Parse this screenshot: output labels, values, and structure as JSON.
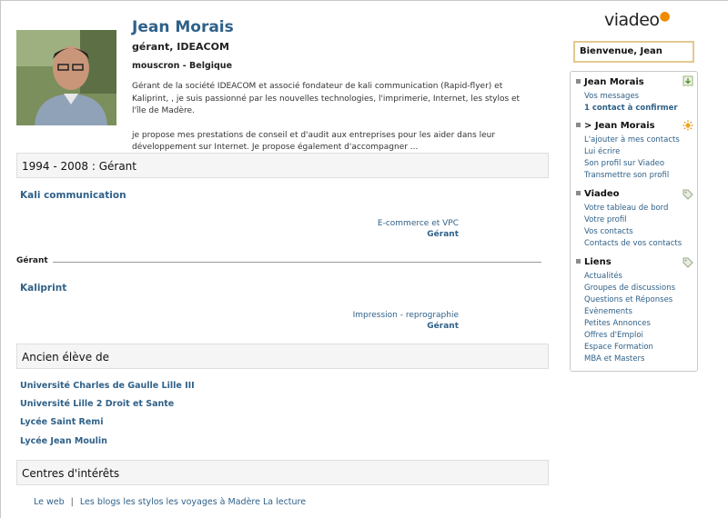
{
  "profile": {
    "name": "Jean Morais",
    "headline": "gérant, IDEACOM",
    "location": "mouscron - Belgique",
    "summary_p1": "Gérant de la société IDEACOM et associé fondateur de kali communication (Rapid-flyer) et Kaliprint, , je suis passionné par les nouvelles technologies, l'imprimerie, Internet, les stylos et l'île de Madère.",
    "summary_p2": "je propose mes prestations de conseil et d'audit aux entreprises pour les aider dans leur développement sur Internet. Je propose également d'accompagner ..."
  },
  "experience": {
    "header": "1994 - 2008 : Gérant",
    "jobs": [
      {
        "company": "Kali communication",
        "sector": "E-commerce et VPC",
        "role": "Gérant"
      },
      {
        "company": "Kaliprint",
        "sector": "Impression - reprographie",
        "role": "Gérant"
      }
    ],
    "subhead": "Gérant"
  },
  "education": {
    "header": "Ancien élève de",
    "schools": [
      "Université Charles de Gaulle Lille III",
      "Université Lille 2 Droit et Sante",
      "Lycée Saint Remi",
      "Lycée Jean Moulin"
    ]
  },
  "interests": {
    "header": "Centres d'intérêts",
    "item1": "Le web",
    "separator": "|",
    "item2": "Les blogs les stylos les voyages à Madère La lecture"
  },
  "sidebar": {
    "logo": "viadeo",
    "welcome": "Bienvenue, Jean",
    "sections": [
      {
        "title": "Jean Morais",
        "icon": "download-icon",
        "links": [
          "Vos messages",
          "1 contact à confirmer"
        ]
      },
      {
        "title": "> Jean Morais",
        "icon": "sun-icon",
        "links": [
          "L'ajouter à mes contacts",
          "Lui écrire",
          "Son profil sur Viadeo",
          "Transmettre son profil"
        ]
      },
      {
        "title": "Viadeo",
        "icon": "tag-icon",
        "links": [
          "Votre tableau de bord",
          "Votre profil",
          "Vos contacts",
          "Contacts de vos contacts"
        ]
      },
      {
        "title": "Liens",
        "icon": "tag-icon",
        "links": [
          "Actualités",
          "Groupes de discussions",
          "Questions et Réponses",
          "Evènements",
          "Petites Annonces",
          "Offres d'Emploi",
          "Espace Formation",
          "MBA et Masters"
        ]
      }
    ]
  },
  "colors": {
    "link": "#2f6189",
    "accent": "#f08b00",
    "welcome_border": "#e2c98f"
  }
}
